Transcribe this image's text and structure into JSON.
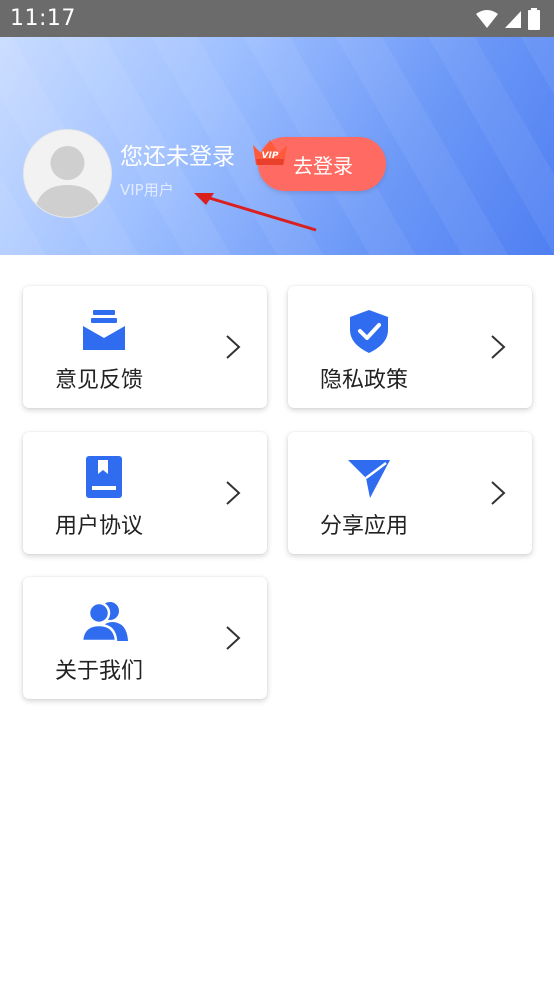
{
  "status_bar": {
    "time": "11:17"
  },
  "profile": {
    "username": "您还未登录",
    "vip_label": "VIP用户",
    "vip_badge_text": "VIP",
    "login_button": "去登录"
  },
  "menu": [
    {
      "label": "意见反馈",
      "icon": "mail-icon"
    },
    {
      "label": "隐私政策",
      "icon": "shield-check-icon"
    },
    {
      "label": "用户协议",
      "icon": "book-icon"
    },
    {
      "label": "分享应用",
      "icon": "send-icon"
    },
    {
      "label": "关于我们",
      "icon": "users-icon"
    }
  ],
  "colors": {
    "accent": "#2f6cf0",
    "login_button": "#ff6b62",
    "header_start": "#c9dcff",
    "header_end": "#4f7ff2"
  }
}
